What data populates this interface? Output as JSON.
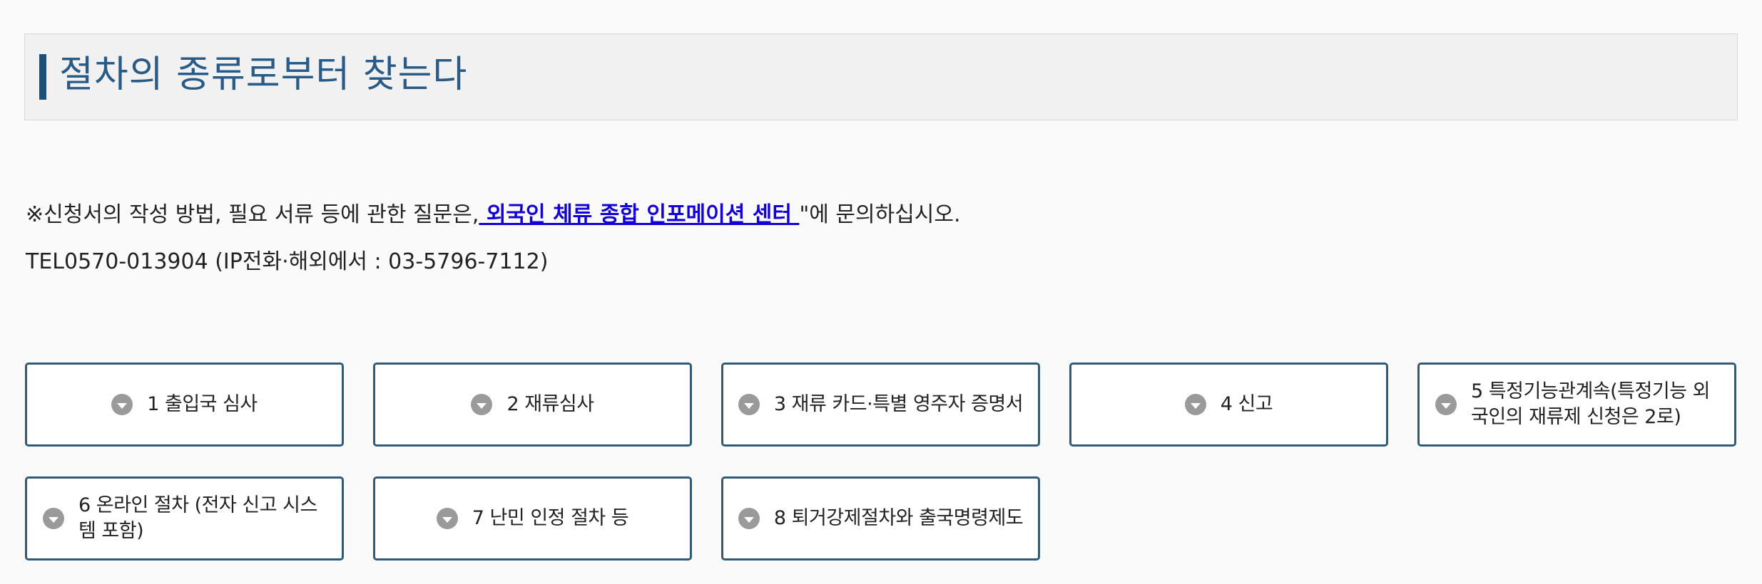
{
  "section": {
    "title": "절차의 종류로부터 찾는다"
  },
  "notice": {
    "prefix": "※신청서의 작성 방법, 필요 서류 등에 관한 질문은,",
    "link_text": " 외국인 체류 종합 인포메이션 센터 ",
    "suffix": "\"에 문의하십시오.",
    "tel": "TEL0570-013904 (IP전화·해외에서 : 03-5796-7112)"
  },
  "procedures": [
    {
      "label": "1 출입국 심사"
    },
    {
      "label": "2 재류심사"
    },
    {
      "label": "3 재류 카드·특별 영주자 증명서"
    },
    {
      "label": "4 신고"
    },
    {
      "label": "5 특정기능관계속(특정기능 외국인의 재류제 신청은 2로)"
    },
    {
      "label": "6 온라인 절차 (전자 신고 시스템 포함)"
    },
    {
      "label": "7 난민 인정 절차 등"
    },
    {
      "label": "8 퇴거강제절차와 출국명령제도"
    }
  ],
  "colors": {
    "heading_text": "#2a5b86",
    "heading_bar": "#1f4e79",
    "button_border": "#2f5a78",
    "link": "#1300d6",
    "chevron": "#9a9a9a"
  }
}
